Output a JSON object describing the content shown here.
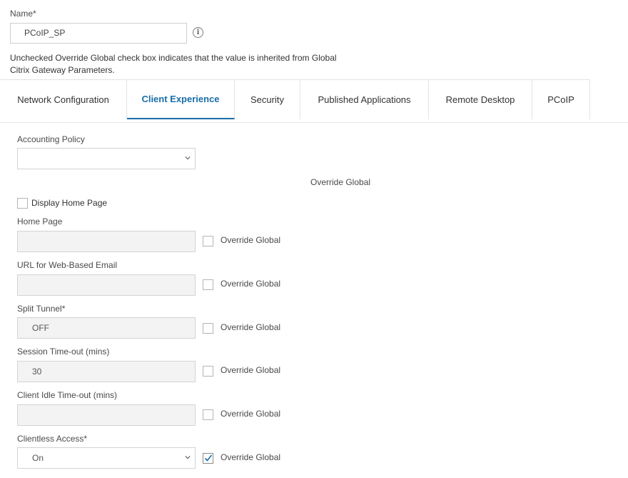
{
  "name_field": {
    "label": "Name*",
    "value": "PCoIP_SP",
    "info_icon": "info-icon"
  },
  "note": "Unchecked Override Global check box indicates that the value is inherited from Global Citrix Gateway Parameters.",
  "tabs": [
    {
      "label": "Network Configuration",
      "active": false
    },
    {
      "label": "Client Experience",
      "active": true
    },
    {
      "label": "Security",
      "active": false
    },
    {
      "label": "Published Applications",
      "active": false
    },
    {
      "label": "Remote Desktop",
      "active": false
    },
    {
      "label": "PCoIP",
      "active": false
    }
  ],
  "accounting_policy": {
    "label": "Accounting Policy",
    "value": ""
  },
  "override_global_header": "Override Global",
  "display_home_page": {
    "label": "Display Home Page",
    "checked": false
  },
  "fields": [
    {
      "label": "Home Page",
      "value": "",
      "override_label": "Override Global",
      "override_checked": false
    },
    {
      "label": "URL for Web-Based Email",
      "value": "",
      "override_label": "Override Global",
      "override_checked": false
    },
    {
      "label": "Split Tunnel*",
      "value": "OFF",
      "override_label": "Override Global",
      "override_checked": false
    },
    {
      "label": "Session Time-out (mins)",
      "value": "30",
      "override_label": "Override Global",
      "override_checked": false
    },
    {
      "label": "Client Idle Time-out (mins)",
      "value": "",
      "override_label": "Override Global",
      "override_checked": false
    },
    {
      "label": "Clientless Access*",
      "value": "On",
      "override_label": "Override Global",
      "override_checked": true
    }
  ],
  "colors": {
    "accent": "#1a6ea8",
    "field_bg": "#f3f3f3",
    "border": "#d3d3d3"
  }
}
